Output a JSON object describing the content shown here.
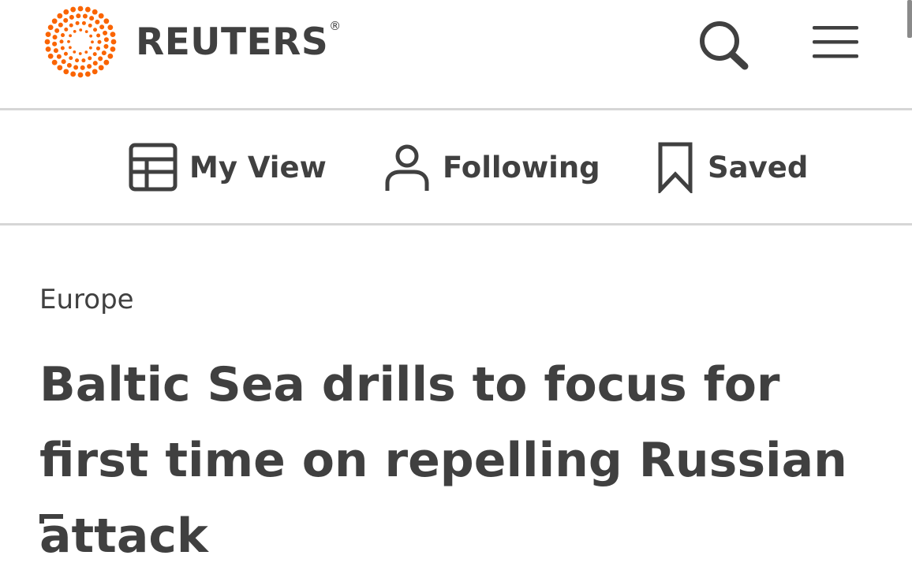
{
  "header": {
    "brand": "REUTERS",
    "registered_mark": "®",
    "brand_color": "#fa6400",
    "icons": {
      "logo": "reuters-dot-ring-logo",
      "search": "search-icon",
      "menu": "hamburger-menu-icon"
    }
  },
  "subnav": {
    "items": [
      {
        "label": "My View",
        "icon": "layout-icon"
      },
      {
        "label": "Following",
        "icon": "person-icon"
      },
      {
        "label": "Saved",
        "icon": "bookmark-icon"
      }
    ]
  },
  "article": {
    "section": "Europe",
    "headline": "Baltic Sea drills to focus for first time on repelling Russian attack"
  },
  "colors": {
    "text": "#404040",
    "divider": "#d6d6d6",
    "background": "#ffffff"
  }
}
